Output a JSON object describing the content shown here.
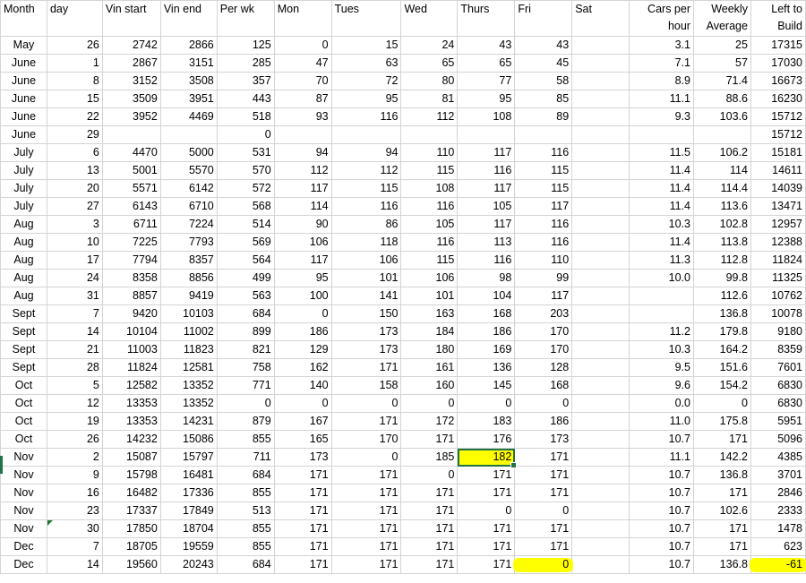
{
  "headers": [
    "Month",
    "day",
    "Vin start",
    "Vin end",
    "Per wk",
    "Mon",
    "Tues",
    "Wed",
    "Thurs",
    "Fri",
    "Sat",
    "Cars per hour",
    "Weekly Average",
    "Left to Build"
  ],
  "rows": [
    [
      "May",
      "26",
      "2742",
      "2866",
      "125",
      "0",
      "15",
      "24",
      "43",
      "43",
      "",
      "3.1",
      "25",
      "17315"
    ],
    [
      "June",
      "1",
      "2867",
      "3151",
      "285",
      "47",
      "63",
      "65",
      "65",
      "45",
      "",
      "7.1",
      "57",
      "17030"
    ],
    [
      "June",
      "8",
      "3152",
      "3508",
      "357",
      "70",
      "72",
      "80",
      "77",
      "58",
      "",
      "8.9",
      "71.4",
      "16673"
    ],
    [
      "June",
      "15",
      "3509",
      "3951",
      "443",
      "87",
      "95",
      "81",
      "95",
      "85",
      "",
      "11.1",
      "88.6",
      "16230"
    ],
    [
      "June",
      "22",
      "3952",
      "4469",
      "518",
      "93",
      "116",
      "112",
      "108",
      "89",
      "",
      "9.3",
      "103.6",
      "15712"
    ],
    [
      "June",
      "29",
      "",
      "",
      "0",
      "",
      "",
      "",
      "",
      "",
      "",
      "",
      "",
      "15712"
    ],
    [
      "July",
      "6",
      "4470",
      "5000",
      "531",
      "94",
      "94",
      "110",
      "117",
      "116",
      "",
      "11.5",
      "106.2",
      "15181"
    ],
    [
      "July",
      "13",
      "5001",
      "5570",
      "570",
      "112",
      "112",
      "115",
      "116",
      "115",
      "",
      "11.4",
      "114",
      "14611"
    ],
    [
      "July",
      "20",
      "5571",
      "6142",
      "572",
      "117",
      "115",
      "108",
      "117",
      "115",
      "",
      "11.4",
      "114.4",
      "14039"
    ],
    [
      "July",
      "27",
      "6143",
      "6710",
      "568",
      "114",
      "116",
      "116",
      "105",
      "117",
      "",
      "11.4",
      "113.6",
      "13471"
    ],
    [
      "Aug",
      "3",
      "6711",
      "7224",
      "514",
      "90",
      "86",
      "105",
      "117",
      "116",
      "",
      "10.3",
      "102.8",
      "12957"
    ],
    [
      "Aug",
      "10",
      "7225",
      "7793",
      "569",
      "106",
      "118",
      "116",
      "113",
      "116",
      "",
      "11.4",
      "113.8",
      "12388"
    ],
    [
      "Aug",
      "17",
      "7794",
      "8357",
      "564",
      "117",
      "106",
      "115",
      "116",
      "110",
      "",
      "11.3",
      "112.8",
      "11824"
    ],
    [
      "Aug",
      "24",
      "8358",
      "8856",
      "499",
      "95",
      "101",
      "106",
      "98",
      "99",
      "",
      "10.0",
      "99.8",
      "11325"
    ],
    [
      "Aug",
      "31",
      "8857",
      "9419",
      "563",
      "100",
      "141",
      "101",
      "104",
      "117",
      "",
      "",
      "112.6",
      "10762"
    ],
    [
      "Sept",
      "7",
      "9420",
      "10103",
      "684",
      "0",
      "150",
      "163",
      "168",
      "203",
      "",
      "",
      "136.8",
      "10078"
    ],
    [
      "Sept",
      "14",
      "10104",
      "11002",
      "899",
      "186",
      "173",
      "184",
      "186",
      "170",
      "",
      "11.2",
      "179.8",
      "9180"
    ],
    [
      "Sept",
      "21",
      "11003",
      "11823",
      "821",
      "129",
      "173",
      "180",
      "169",
      "170",
      "",
      "10.3",
      "164.2",
      "8359"
    ],
    [
      "Sept",
      "28",
      "11824",
      "12581",
      "758",
      "162",
      "171",
      "161",
      "136",
      "128",
      "",
      "9.5",
      "151.6",
      "7601"
    ],
    [
      "Oct",
      "5",
      "12582",
      "13352",
      "771",
      "140",
      "158",
      "160",
      "145",
      "168",
      "",
      "9.6",
      "154.2",
      "6830"
    ],
    [
      "Oct",
      "12",
      "13353",
      "13352",
      "0",
      "0",
      "0",
      "0",
      "0",
      "0",
      "",
      "0.0",
      "0",
      "6830"
    ],
    [
      "Oct",
      "19",
      "13353",
      "14231",
      "879",
      "167",
      "171",
      "172",
      "183",
      "186",
      "",
      "11.0",
      "175.8",
      "5951"
    ],
    [
      "Oct",
      "26",
      "14232",
      "15086",
      "855",
      "165",
      "170",
      "171",
      "176",
      "173",
      "",
      "10.7",
      "171",
      "5096"
    ],
    [
      "Nov",
      "2",
      "15087",
      "15797",
      "711",
      "173",
      "0",
      "185",
      "182",
      "171",
      "",
      "11.1",
      "142.2",
      "4385"
    ],
    [
      "Nov",
      "9",
      "15798",
      "16481",
      "684",
      "171",
      "171",
      "0",
      "171",
      "171",
      "",
      "10.7",
      "136.8",
      "3701"
    ],
    [
      "Nov",
      "16",
      "16482",
      "17336",
      "855",
      "171",
      "171",
      "171",
      "171",
      "171",
      "",
      "10.7",
      "171",
      "2846"
    ],
    [
      "Nov",
      "23",
      "17337",
      "17849",
      "513",
      "171",
      "171",
      "171",
      "0",
      "0",
      "",
      "10.7",
      "102.6",
      "2333"
    ],
    [
      "Nov",
      "30",
      "17850",
      "18704",
      "855",
      "171",
      "171",
      "171",
      "171",
      "171",
      "",
      "10.7",
      "171",
      "1478"
    ],
    [
      "Dec",
      "7",
      "18705",
      "19559",
      "855",
      "171",
      "171",
      "171",
      "171",
      "171",
      "",
      "10.7",
      "171",
      "623"
    ],
    [
      "Dec",
      "14",
      "19560",
      "20243",
      "684",
      "171",
      "171",
      "171",
      "171",
      "0",
      "",
      "10.7",
      "136.8",
      "-61"
    ]
  ],
  "selected_cell": {
    "row": 23,
    "col": 8
  },
  "highlighted_cells": [
    {
      "row": 29,
      "col": 9
    },
    {
      "row": 29,
      "col": 13
    }
  ],
  "comment_marker_cells": [
    {
      "row": 27,
      "col": 1
    }
  ],
  "colors": {
    "selection_border": "#217346",
    "highlight": "#ffff00",
    "gridline": "#d4d4d4"
  }
}
